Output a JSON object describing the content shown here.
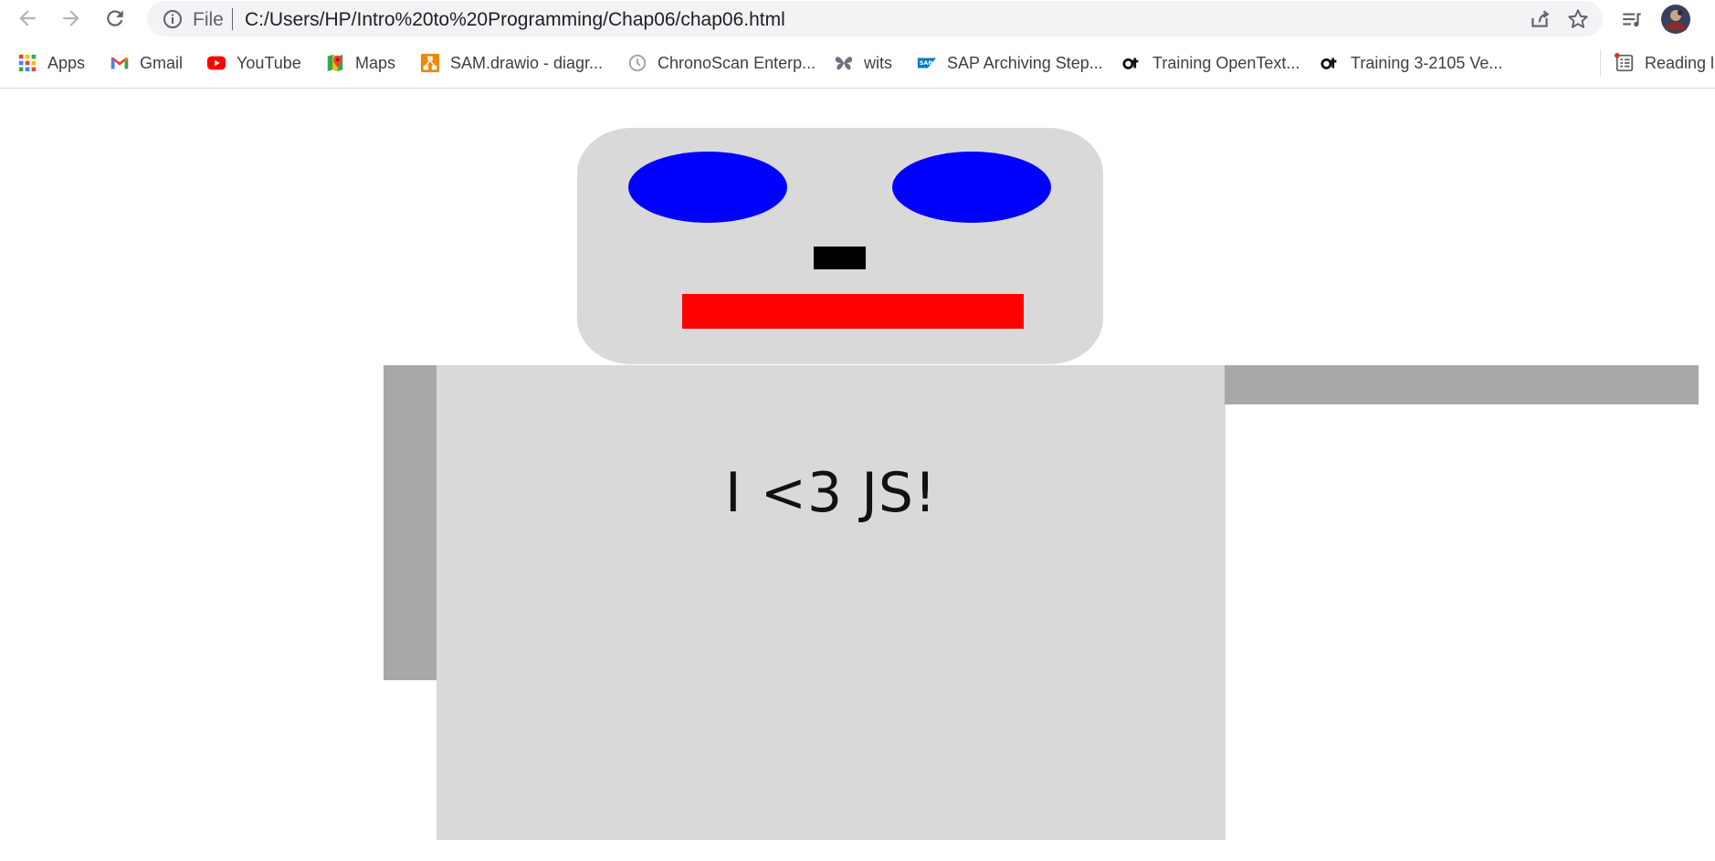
{
  "browser": {
    "address": {
      "scheme_label": "File",
      "url": "C:/Users/HP/Intro%20to%20Programming/Chap06/chap06.html"
    },
    "bookmarks": [
      {
        "label": "Apps",
        "icon": "apps-grid-icon"
      },
      {
        "label": "Gmail",
        "icon": "gmail-icon"
      },
      {
        "label": "YouTube",
        "icon": "youtube-icon"
      },
      {
        "label": "Maps",
        "icon": "maps-icon"
      },
      {
        "label": "SAM.drawio - diagr...",
        "icon": "drawio-icon"
      },
      {
        "label": "ChronoScan Enterp...",
        "icon": "clock-icon"
      },
      {
        "label": "wits",
        "icon": "butterfly-icon"
      },
      {
        "label": "SAP Archiving Step...",
        "icon": "sap-icon"
      },
      {
        "label": "Training OpenText...",
        "icon": "opentext-icon"
      },
      {
        "label": "Training 3-2105 Ve...",
        "icon": "opentext-icon"
      }
    ],
    "reading_list_label": "Reading l"
  },
  "page": {
    "shirt_text": "I <3 JS!"
  },
  "colors": {
    "head_body": "#d9d9d9",
    "arms": "#a8a8a8",
    "eyes": "#0000ff",
    "nose": "#000000",
    "mouth": "#ff0000"
  }
}
